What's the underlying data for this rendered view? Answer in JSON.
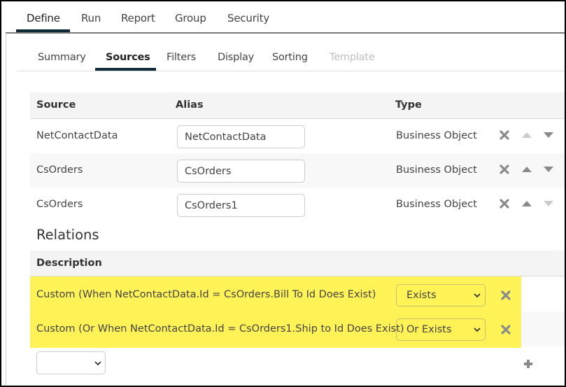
{
  "top_tabs": [
    {
      "label": "Define",
      "active": true
    },
    {
      "label": "Run",
      "active": false
    },
    {
      "label": "Report",
      "active": false
    },
    {
      "label": "Group",
      "active": false
    },
    {
      "label": "Security",
      "active": false
    }
  ],
  "sub_tabs": [
    {
      "label": "Summary",
      "state": "normal"
    },
    {
      "label": "Sources",
      "state": "active"
    },
    {
      "label": "Filters",
      "state": "normal"
    },
    {
      "label": "Display",
      "state": "normal"
    },
    {
      "label": "Sorting",
      "state": "normal"
    },
    {
      "label": "Template",
      "state": "disabled"
    }
  ],
  "sources": {
    "headers": {
      "source": "Source",
      "alias": "Alias",
      "type": "Type"
    },
    "rows": [
      {
        "source": "NetContactData",
        "alias": "NetContactData",
        "type": "Business Object",
        "up_enabled": false,
        "down_enabled": true
      },
      {
        "source": "CsOrders",
        "alias": "CsOrders",
        "type": "Business Object",
        "up_enabled": true,
        "down_enabled": true
      },
      {
        "source": "CsOrders",
        "alias": "CsOrders1",
        "type": "Business Object",
        "up_enabled": true,
        "down_enabled": false
      }
    ]
  },
  "relations": {
    "title": "Relations",
    "header": "Description",
    "rows": [
      {
        "description": "Custom (When NetContactData.Id = CsOrders.Bill To Id Does Exist)",
        "type": "Exists"
      },
      {
        "description": "Custom (Or When NetContactData.Id = CsOrders1.Ship to Id Does Exist)",
        "type": "Or Exists"
      }
    ],
    "new_relation_select": ""
  },
  "icons": {
    "remove": "close-x-icon",
    "move_up": "triangle-up-icon",
    "move_down": "triangle-down-icon",
    "add": "plus-icon",
    "dropdown": "chevron-down-icon"
  },
  "colors": {
    "accent": "#0e2a36",
    "highlight": "#fbf04f",
    "icon_gray": "#8a8a8a",
    "icon_disabled": "#cccccc",
    "disabled_text": "#c0c0c0"
  }
}
